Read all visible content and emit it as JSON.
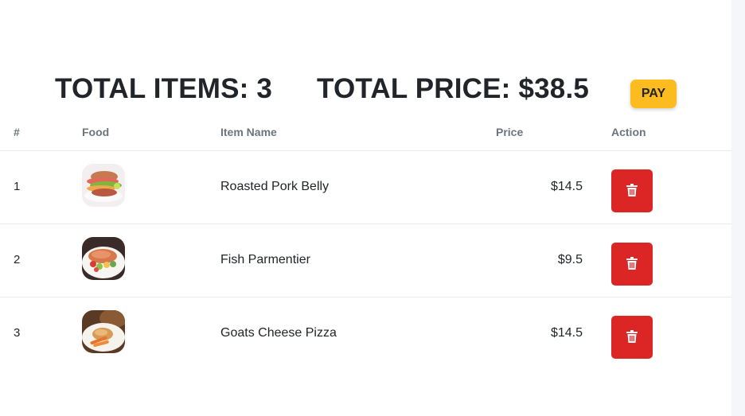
{
  "summary": {
    "total_items": "TOTAL ITEMS: 3",
    "total_price": "TOTAL PRICE: $38.5",
    "pay_label": "PAY"
  },
  "table": {
    "headers": [
      "#",
      "Food",
      "Item Name",
      "Price",
      "Action"
    ],
    "rows": [
      {
        "index": "1",
        "name": "Roasted Pork Belly",
        "price": "$14.5",
        "image": "pork-belly-burger"
      },
      {
        "index": "2",
        "name": "Fish Parmentier",
        "price": "$9.5",
        "image": "salmon-fillet"
      },
      {
        "index": "3",
        "name": "Goats Cheese Pizza",
        "price": "$14.5",
        "image": "plated-fish-dish"
      }
    ]
  },
  "icons": {
    "delete": "trash-icon"
  },
  "colors": {
    "pay_button": "#fcbc1f",
    "delete_button": "#dc2626",
    "header_text": "#6c757d",
    "text": "#212529"
  }
}
